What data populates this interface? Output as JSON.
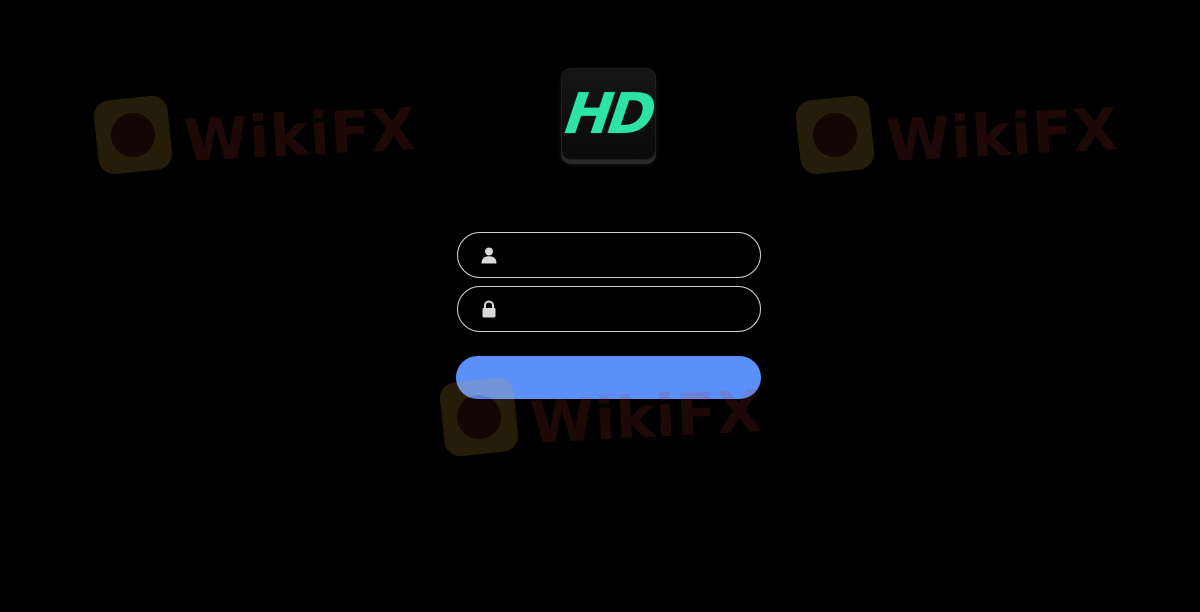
{
  "logo": {
    "text": "HD",
    "color": "#2ee3a6"
  },
  "login_form": {
    "username_field": {
      "value": "",
      "placeholder": "",
      "icon": "user-icon"
    },
    "password_field": {
      "value": "",
      "placeholder": "",
      "icon": "lock-icon"
    },
    "submit_button": {
      "label": "",
      "color": "#5b8ff9"
    }
  },
  "watermark": {
    "text": "WikiFX",
    "subtext": "",
    "icon": "wikifx-badge-icon",
    "color": "#c23b2a"
  },
  "theme": {
    "background": "#000000",
    "field_border": "#cfcfcf"
  }
}
